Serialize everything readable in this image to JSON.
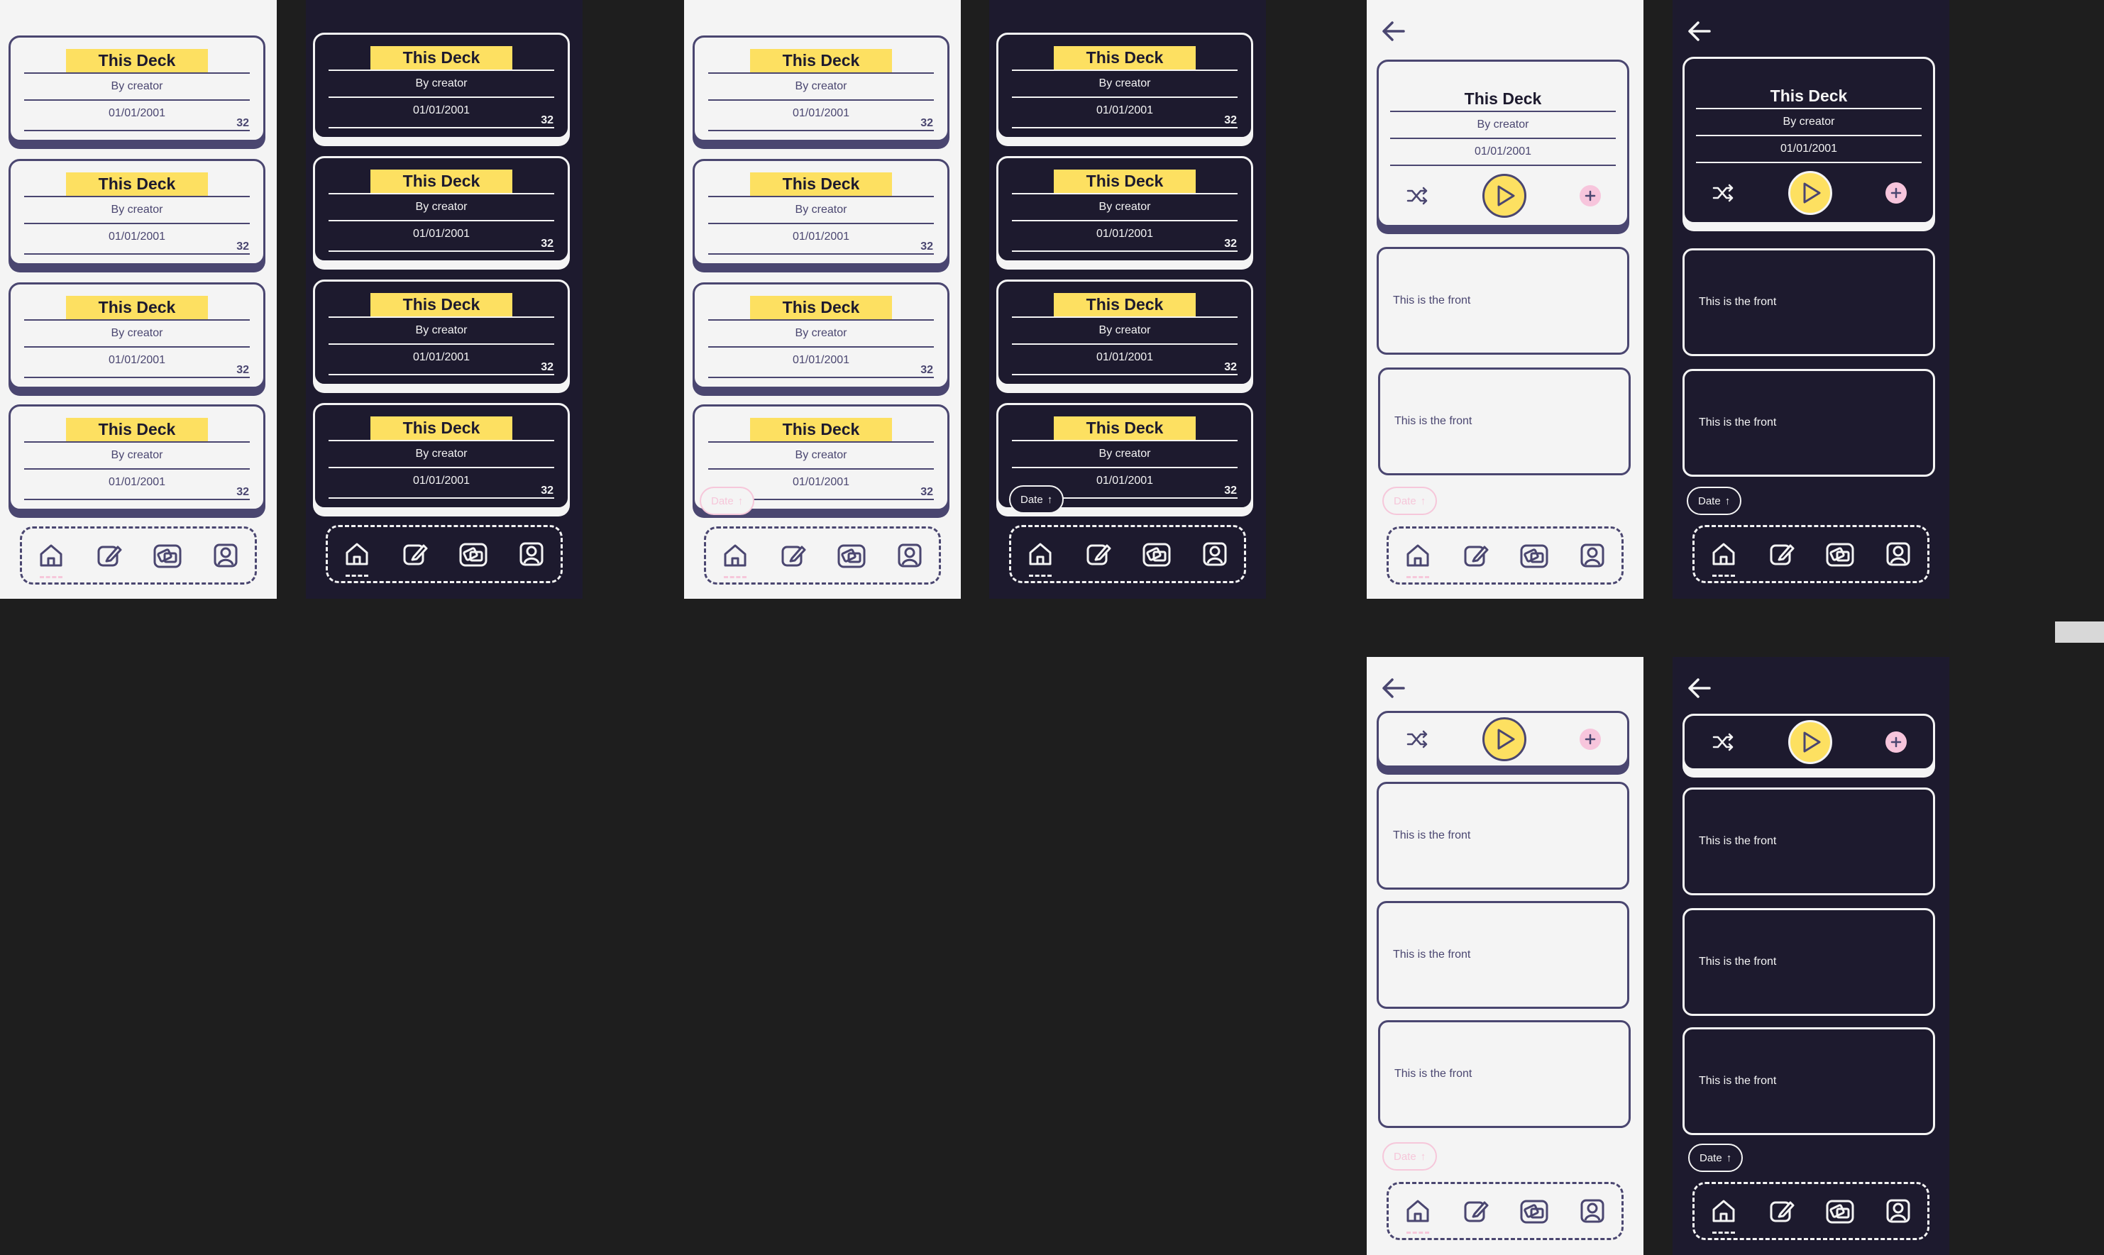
{
  "deck": {
    "title": "This Deck",
    "creator": "By creator",
    "date": "01/01/2001",
    "count": "32"
  },
  "front_text": "This is the front",
  "chip_label": "Date",
  "chip_arrow": "↑",
  "colors": {
    "background": "#1e1e1e",
    "light_surface": "#f4f4f4",
    "dark_surface": "#1d1a2e",
    "accent_yellow": "#fde061",
    "accent_purple": "#4a4670",
    "accent_pink": "#f7c5dc"
  },
  "nav_icons": [
    "home-icon",
    "edit-icon",
    "cards-icon",
    "profile-icon"
  ],
  "detail_icons": [
    "shuffle-icon",
    "play-icon",
    "plus-icon"
  ]
}
